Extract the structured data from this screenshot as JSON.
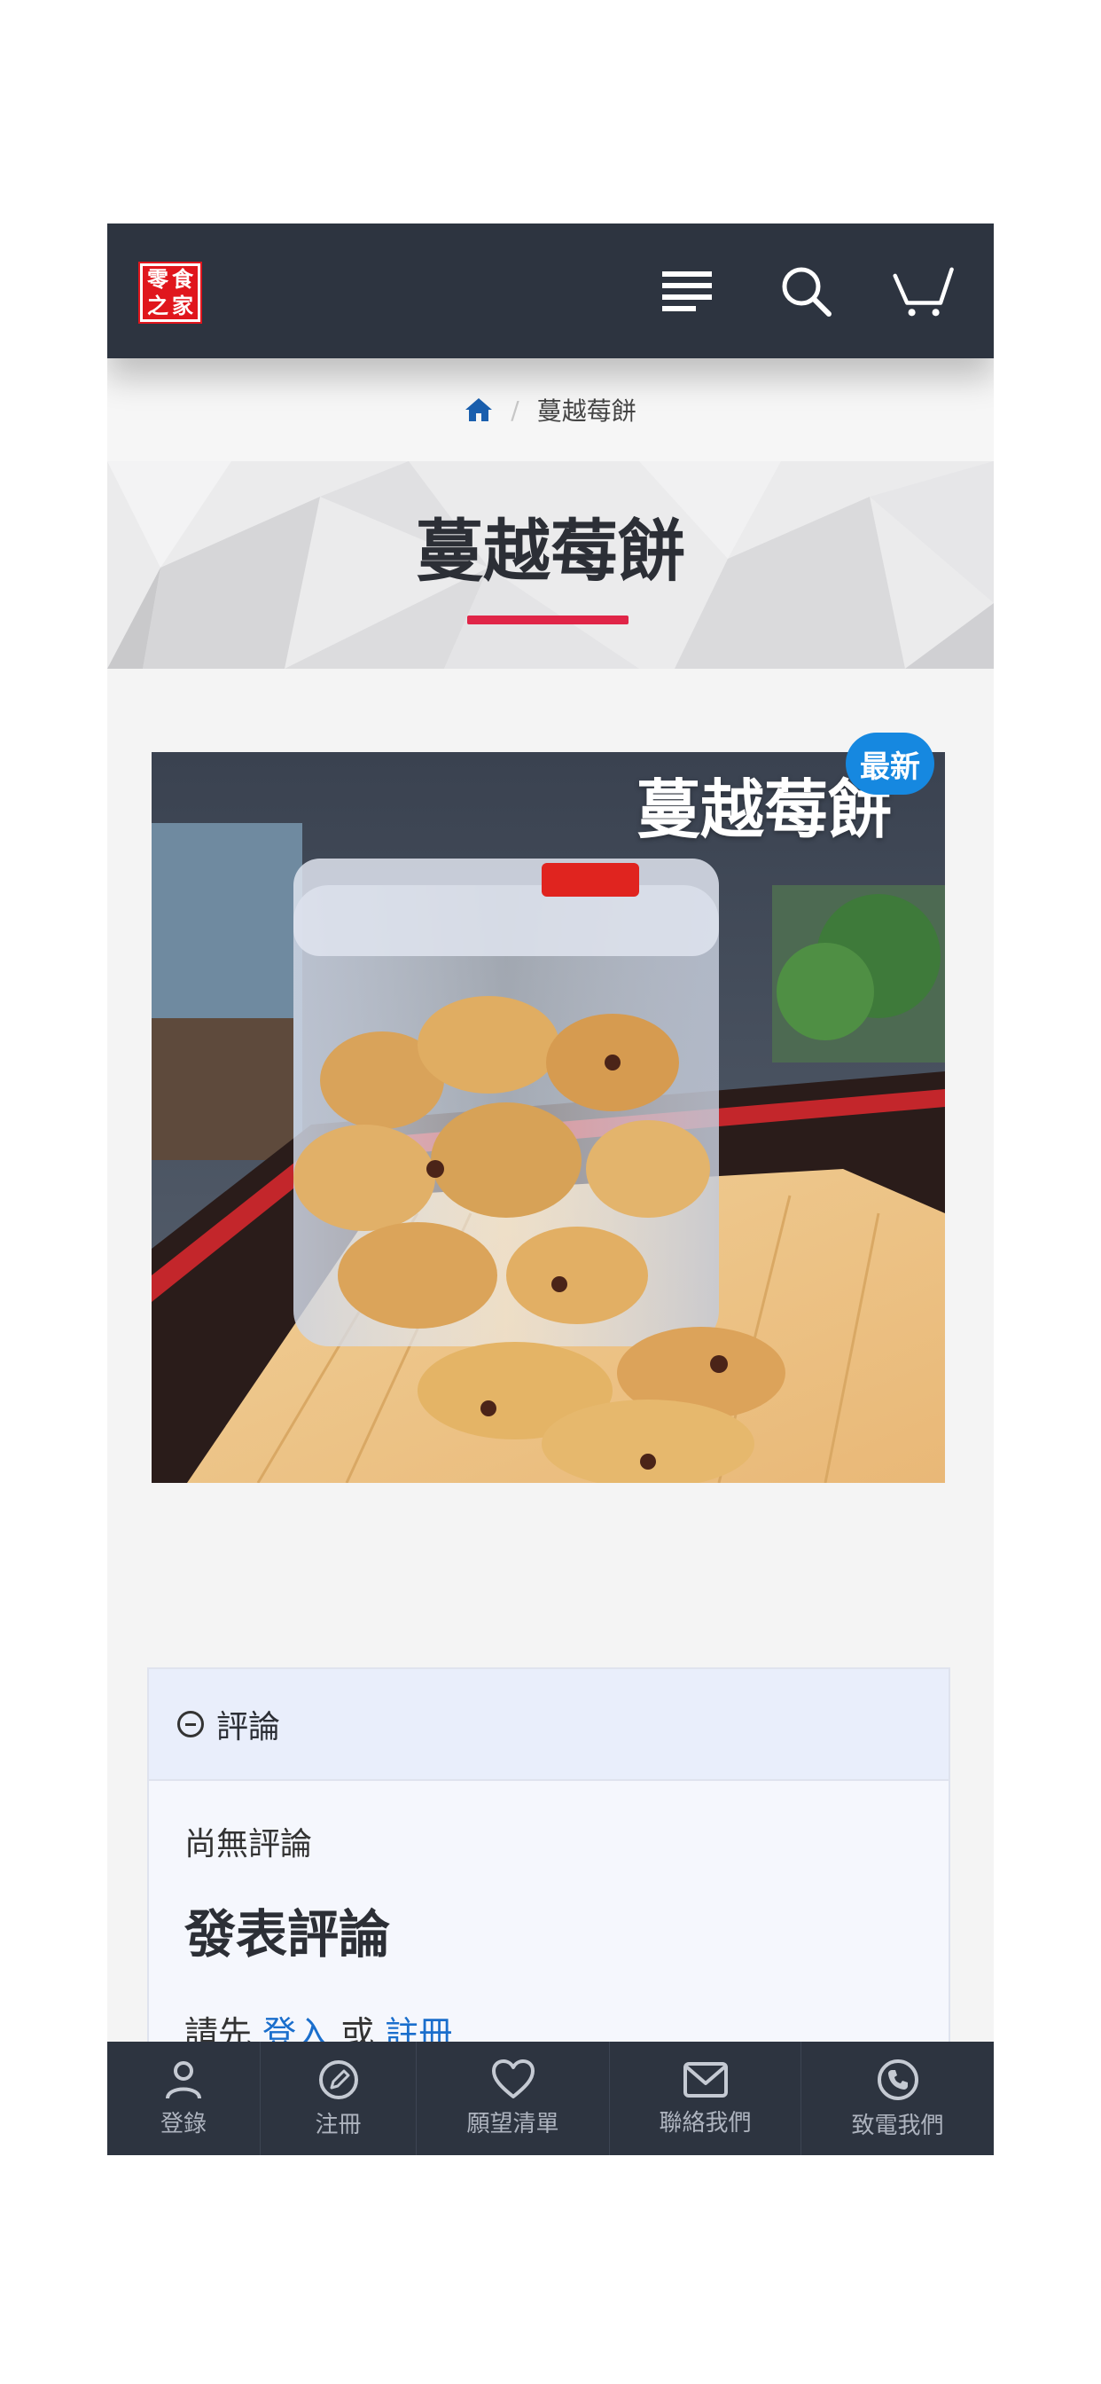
{
  "header": {
    "logo_chars": [
      "零",
      "食",
      "之",
      "家"
    ],
    "icons": [
      "menu-icon",
      "search-icon",
      "cart-icon"
    ]
  },
  "breadcrumb": {
    "home_icon": "home-icon",
    "separator": "/",
    "current": "蔓越莓餅"
  },
  "page": {
    "title": "蔓越莓餅"
  },
  "product": {
    "image_caption": "蔓越莓餅",
    "badge": "最新"
  },
  "reviews": {
    "header_label": "評論",
    "empty_text": "尚無評論",
    "write_title": "發表評論",
    "login_prefix": "請先",
    "login_link": "登入",
    "or_text": "或",
    "register_link": "註冊"
  },
  "bottom_nav": {
    "items": [
      {
        "label": "登錄",
        "icon": "user-icon"
      },
      {
        "label": "注冊",
        "icon": "edit-icon"
      },
      {
        "label": "願望清單",
        "icon": "heart-icon"
      },
      {
        "label": "聯絡我們",
        "icon": "mail-icon"
      },
      {
        "label": "致電我們",
        "icon": "phone-icon"
      }
    ]
  },
  "colors": {
    "header_bg": "#2d3440",
    "accent_red": "#e02548",
    "badge_blue": "#1688e0",
    "link_blue": "#1a6ecc"
  }
}
